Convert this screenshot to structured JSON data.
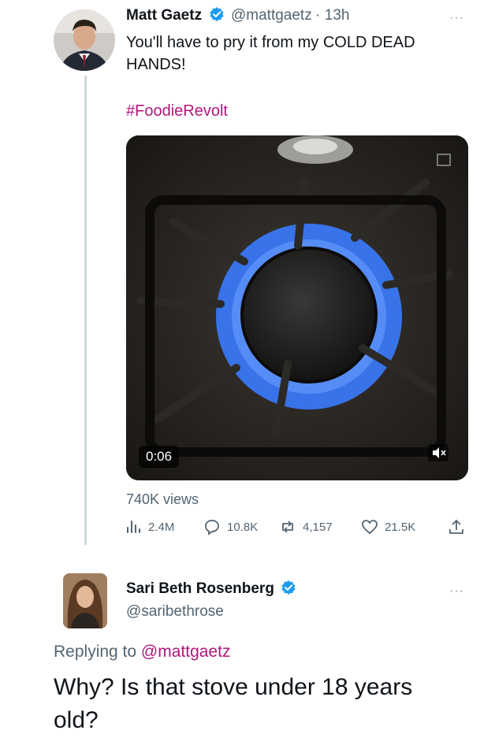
{
  "tweet": {
    "author_name": "Matt Gaetz",
    "author_handle": "@mattgaetz",
    "time": "· 13h",
    "more": "···",
    "text": "You'll have to pry it from my COLD DEAD HANDS!",
    "hashtag": "#FoodieRevolt",
    "video_duration": "0:06",
    "views": "740K views",
    "stats": {
      "analytics": "2.4M",
      "replies": "10.8K",
      "retweets": "4,157",
      "likes": "21.5K"
    }
  },
  "reply": {
    "author_name": "Sari Beth Rosenberg",
    "author_handle": "@saribethrose",
    "more": "···",
    "replying_prefix": "Replying to",
    "replying_handle": "@mattgaetz",
    "text": "Why? Is that stove under 18 years old?"
  },
  "colors": {
    "verified": "#1d9bf0",
    "hashtag": "#b0177d",
    "secondary_text": "#536471",
    "flame": "#3a7bff"
  }
}
